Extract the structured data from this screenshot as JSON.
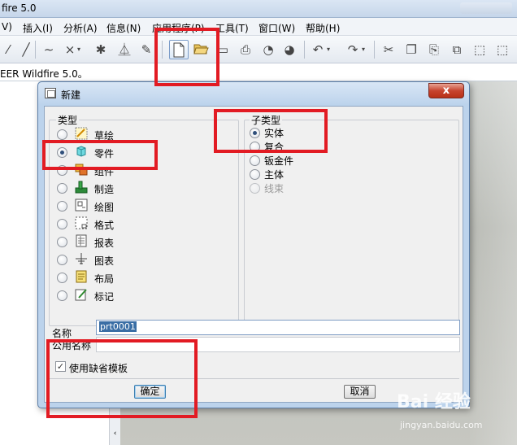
{
  "app": {
    "title": "fire 5.0"
  },
  "menubar": {
    "items": [
      {
        "label": "V)"
      },
      {
        "label": "插入(I)"
      },
      {
        "label": "分析(A)"
      },
      {
        "label": "信息(N)"
      },
      {
        "label": "应用程序(P)"
      },
      {
        "label": "工具(T)"
      },
      {
        "label": "窗口(W)"
      },
      {
        "label": "帮助(H)"
      }
    ]
  },
  "toolbar": {
    "icons": [
      "line-icon",
      "line-icon",
      "curve-icon",
      "point-icon",
      "axis-icon",
      "datum-icon",
      "sketch-icon",
      "new-file-icon",
      "open-folder-icon",
      "save-icon",
      "print-icon",
      "mail-icon",
      "mail-icon",
      "undo-icon",
      "redo-icon",
      "cut-icon",
      "copy-icon",
      "paste-icon",
      "paste-special-icon",
      "select-box-icon",
      "more-icon"
    ]
  },
  "message_bar": {
    "text": "EER Wildfire 5.0。"
  },
  "dialog": {
    "title": "新建",
    "close_label": "x",
    "type_group": {
      "label": "类型",
      "items": [
        {
          "label": "草绘",
          "checked": false,
          "icon": "sketch-icon"
        },
        {
          "label": "零件",
          "checked": true,
          "icon": "part-icon"
        },
        {
          "label": "组件",
          "checked": false,
          "icon": "assembly-icon"
        },
        {
          "label": "制造",
          "checked": false,
          "icon": "manufacturing-icon"
        },
        {
          "label": "绘图",
          "checked": false,
          "icon": "drawing-icon"
        },
        {
          "label": "格式",
          "checked": false,
          "icon": "format-icon"
        },
        {
          "label": "报表",
          "checked": false,
          "icon": "report-icon"
        },
        {
          "label": "图表",
          "checked": false,
          "icon": "diagram-icon"
        },
        {
          "label": "布局",
          "checked": false,
          "icon": "layout-icon"
        },
        {
          "label": "标记",
          "checked": false,
          "icon": "markup-icon"
        }
      ]
    },
    "subtype_group": {
      "label": "子类型",
      "items": [
        {
          "label": "实体",
          "checked": true,
          "disabled": false
        },
        {
          "label": "复合",
          "checked": false,
          "disabled": false
        },
        {
          "label": "钣金件",
          "checked": false,
          "disabled": false
        },
        {
          "label": "主体",
          "checked": false,
          "disabled": false
        },
        {
          "label": "线束",
          "checked": false,
          "disabled": true
        }
      ]
    },
    "name_label": "名称",
    "name_value": "prt0001",
    "common_name_label": "公用名称",
    "common_name_value": "",
    "use_default_template_label": "使用缺省模板",
    "use_default_template_checked": true,
    "ok_label": "确定",
    "cancel_label": "取消"
  },
  "scroll_arrow": "‹",
  "watermark": {
    "line1": "Bai 经验",
    "line2": "jingyan.baidu.com"
  },
  "colors": {
    "annotation_red": "#e21b23",
    "selection_blue": "#3a6ea5",
    "close_red": "#c7442f"
  }
}
